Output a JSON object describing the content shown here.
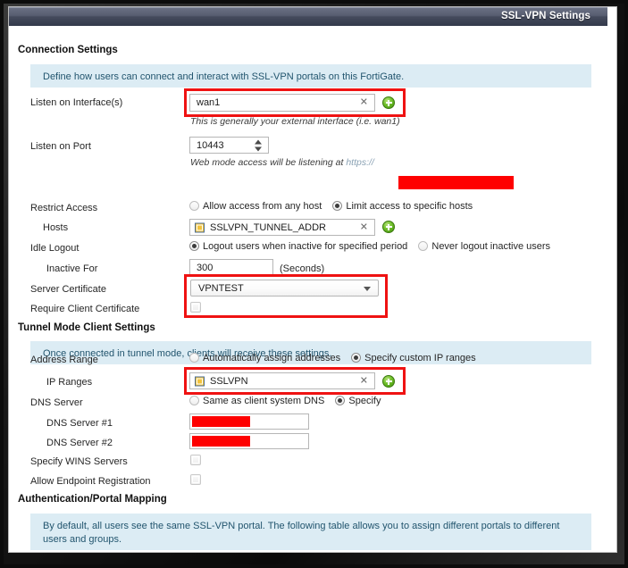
{
  "window": {
    "title": "SSL-VPN Settings"
  },
  "sections": {
    "connection": {
      "heading": "Connection Settings",
      "banner": "Define how users can connect and interact with SSL-VPN portals on this FortiGate.",
      "fields": {
        "listen_interface": {
          "label": "Listen on Interface(s)",
          "value": "wan1",
          "clear_glyph": "✕",
          "add_icon": "plus-icon",
          "hint": "This is generally your external interface (i.e. wan1)"
        },
        "listen_port": {
          "label": "Listen on Port",
          "value": "10443",
          "hint_prefix": "Web mode access will be listening at ",
          "hint_scheme": "https://",
          "hint_redacted": true
        },
        "restrict_access": {
          "label": "Restrict Access",
          "options": [
            {
              "label": "Allow access from any host",
              "selected": false
            },
            {
              "label": "Limit access to specific hosts",
              "selected": true
            }
          ]
        },
        "hosts": {
          "label": "Hosts",
          "value": "SSLVPN_TUNNEL_ADDR",
          "object_icon": "address-object-icon",
          "clear_glyph": "✕",
          "add_icon": "plus-icon"
        },
        "idle_logout": {
          "label": "Idle Logout",
          "options": [
            {
              "label": "Logout users when inactive for specified period",
              "selected": true
            },
            {
              "label": "Never logout inactive users",
              "selected": false
            }
          ]
        },
        "inactive_for": {
          "label": "Inactive For",
          "value": "300",
          "units": "(Seconds)"
        },
        "server_certificate": {
          "label": "Server Certificate",
          "value": "VPNTEST",
          "caret_icon": "chevron-down-icon"
        },
        "require_client_certificate": {
          "label": "Require Client Certificate",
          "checked": false
        }
      }
    },
    "tunnel": {
      "heading": "Tunnel Mode Client Settings",
      "banner": "Once connected in tunnel mode, clients will receive these settings.",
      "fields": {
        "address_range": {
          "label": "Address Range",
          "options": [
            {
              "label": "Automatically assign addresses",
              "selected": false
            },
            {
              "label": "Specify custom IP ranges",
              "selected": true
            }
          ]
        },
        "ip_ranges": {
          "label": "IP Ranges",
          "value": "SSLVPN",
          "object_icon": "address-object-icon",
          "clear_glyph": "✕",
          "add_icon": "plus-icon"
        },
        "dns_server": {
          "label": "DNS Server",
          "options": [
            {
              "label": "Same as client system DNS",
              "selected": false
            },
            {
              "label": "Specify",
              "selected": true
            }
          ]
        },
        "dns_server_1": {
          "label": "DNS Server #1",
          "value": "",
          "redacted": true
        },
        "dns_server_2": {
          "label": "DNS Server #2",
          "value": "",
          "redacted": true
        },
        "specify_wins": {
          "label": "Specify WINS Servers",
          "checked": false
        },
        "allow_endpoint_registration": {
          "label": "Allow Endpoint Registration",
          "checked": false
        }
      }
    },
    "auth": {
      "heading": "Authentication/Portal Mapping",
      "banner": "By default, all users see the same SSL-VPN portal. The following table allows you to assign different portals to different users and groups."
    }
  },
  "annotations": {
    "highlight_color": "#ef1212",
    "redaction_color": "#fe0000",
    "highlights": [
      "listen-interface-highlight",
      "server-certificate-highlight",
      "ip-ranges-highlight"
    ]
  }
}
